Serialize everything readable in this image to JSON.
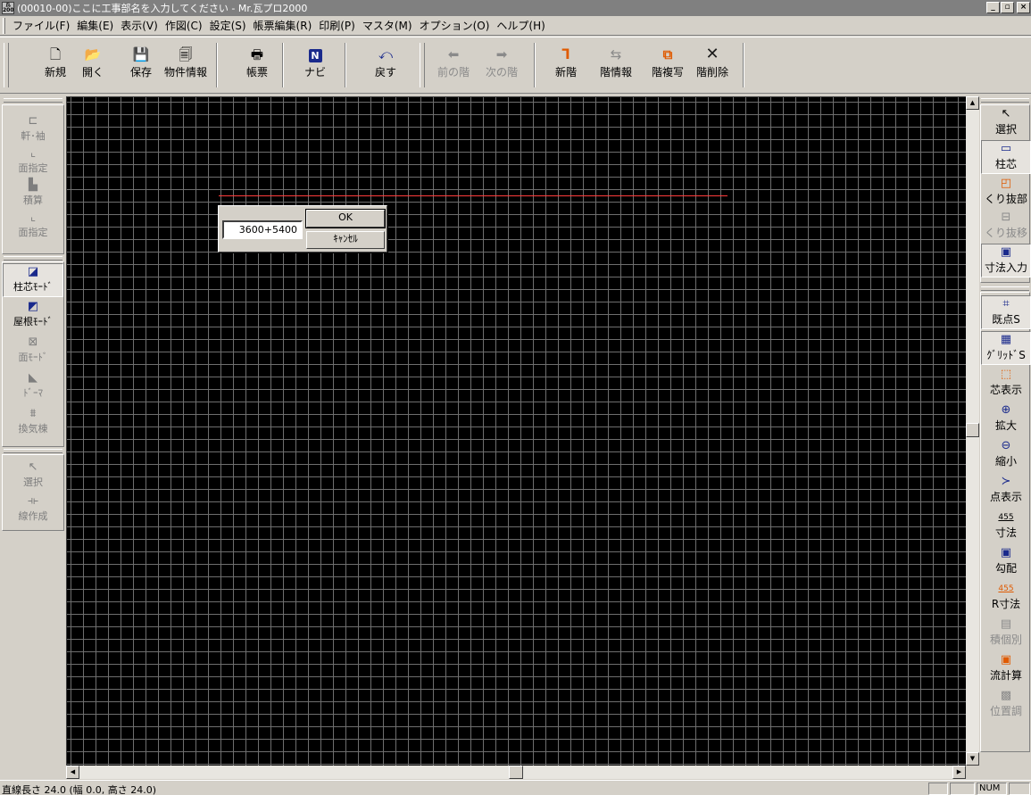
{
  "window": {
    "app_icon_text": "瓦\n2000",
    "title": "(00010-00)ここに工事部名を入力してください - Mr.瓦プロ2000",
    "controls": [
      "_",
      "▫",
      "×"
    ]
  },
  "menu": [
    "ファイル(F)",
    "編集(E)",
    "表示(V)",
    "作図(C)",
    "設定(S)",
    "帳票編集(R)",
    "印刷(P)",
    "マスタ(M)",
    "オプション(O)",
    "ヘルプ(H)"
  ],
  "toolbar": {
    "new": "新規",
    "open": "開く",
    "save": "保存",
    "property_info": "物件情報",
    "report": "帳票",
    "navi": "ナビ",
    "back": "戻す",
    "prev_floor": "前の階",
    "next_floor": "次の階",
    "new_floor": "新階",
    "floor_info": "階情報",
    "floor_copy": "階複写",
    "floor_delete": "階削除"
  },
  "left_panel": {
    "eaves_sleeve": "軒･袖",
    "face_spec_1": "面指定",
    "estimate": "積算",
    "face_spec_2": "面指定",
    "pillar_mode": "柱芯ﾓｰﾄﾞ",
    "roof_mode": "屋根ﾓｰﾄﾞ",
    "face_mode": "面ﾓｰﾄﾞ",
    "dormer": "ﾄﾞｰﾏ",
    "ventilation": "換気棟",
    "select": "選択",
    "line_create": "線作成"
  },
  "right_panel": {
    "select": "選択",
    "pillar_core": "柱芯",
    "cutout": "くり抜部",
    "cutout_move": "くり抜移",
    "dim_input": "寸法入力",
    "existing_snap": "既点S",
    "grid_snap": "ｸﾞﾘｯﾄﾞS",
    "core_display": "芯表示",
    "zoom_in": "拡大",
    "zoom_out": "縮小",
    "point_display": "点表示",
    "dimension": "寸法",
    "slope": "勾配",
    "r_dimension": "R寸法",
    "individual": "積個別",
    "flow_calc": "流計算",
    "position_adjust": "位置調",
    "dim_icon_text": "455",
    "r_dim_icon_text": "455"
  },
  "dialog": {
    "input_value": "3600+5400",
    "ok": "OK",
    "cancel": "ｷｬﾝｾﾙ"
  },
  "status": {
    "text": "直線長さ 24.0 (幅 0.0, 高さ 24.0)",
    "num": "NUM"
  },
  "colors": {
    "canvas_bg": "#000000",
    "grid_line": "#6e6e6e",
    "guide_line": "#ff3c3c",
    "orange_icon": "#e05a00",
    "navy_icon": "#1a2a8c"
  }
}
